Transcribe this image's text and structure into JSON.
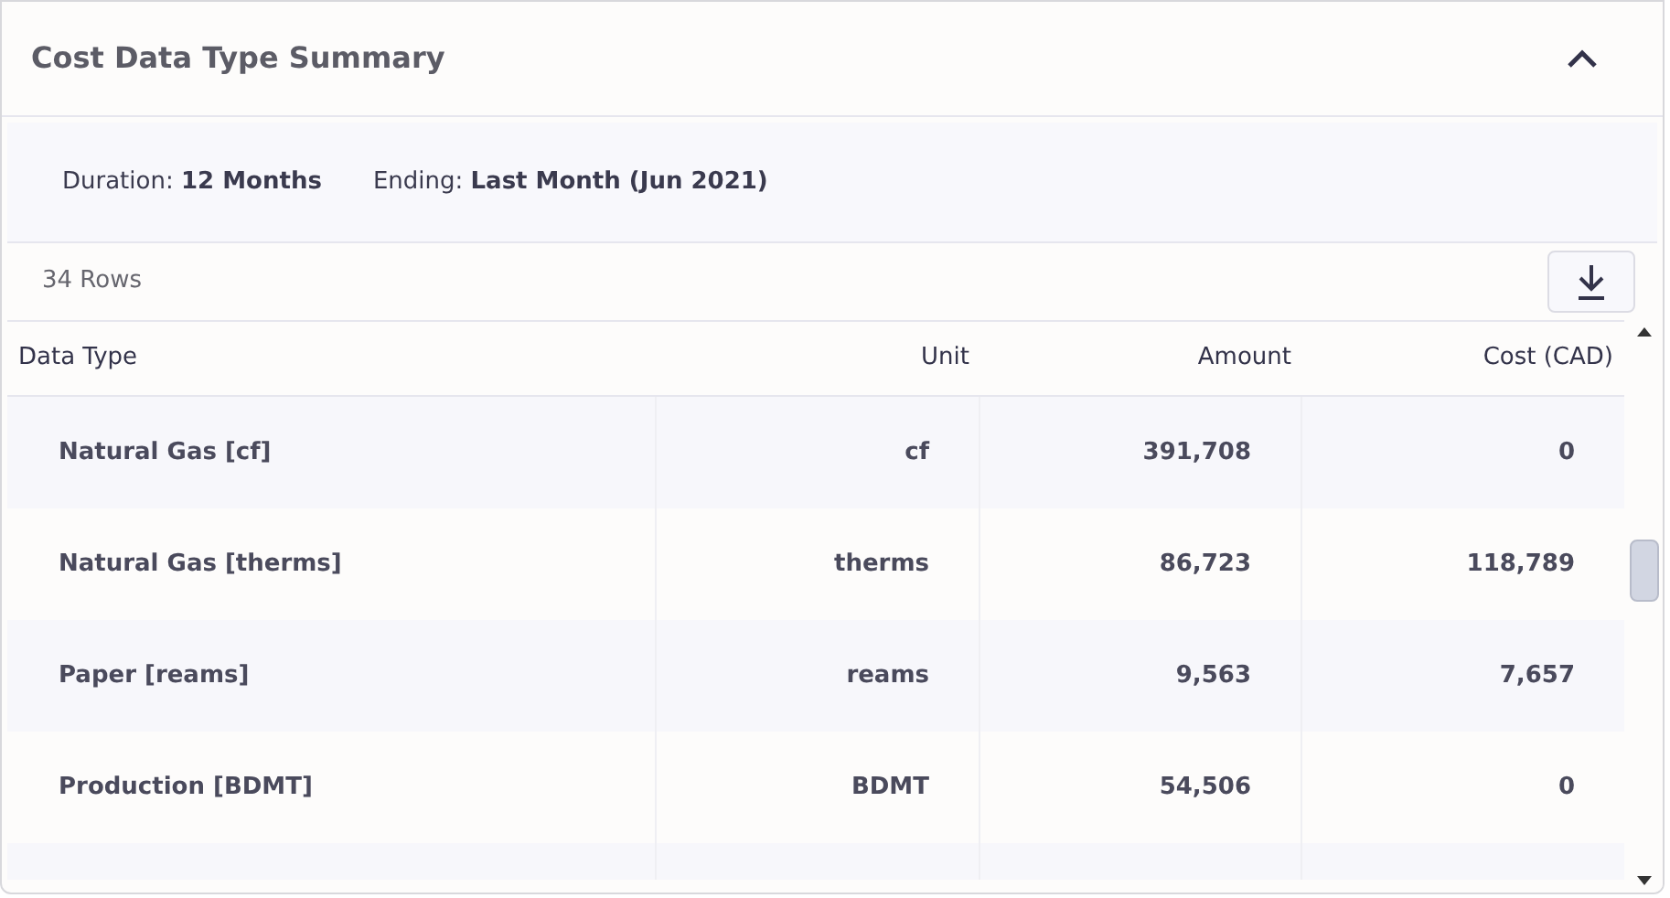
{
  "panel": {
    "title": "Cost Data Type Summary",
    "expanded": true
  },
  "filters": [
    {
      "label": "Duration:",
      "value": "12 Months"
    },
    {
      "label": "Ending:",
      "value": "Last Month (Jun 2021)"
    }
  ],
  "row_count": "34 Rows",
  "table": {
    "columns": [
      "Data Type",
      "Unit",
      "Amount",
      "Cost (CAD)"
    ],
    "rows": [
      [
        "Natural Gas [cf]",
        "cf",
        "391,708",
        "0"
      ],
      [
        "Natural Gas [therms]",
        "therms",
        "86,723",
        "118,789"
      ],
      [
        "Paper [reams]",
        "reams",
        "9,563",
        "7,657"
      ],
      [
        "Production [BDMT]",
        "BDMT",
        "54,506",
        "0"
      ]
    ]
  }
}
